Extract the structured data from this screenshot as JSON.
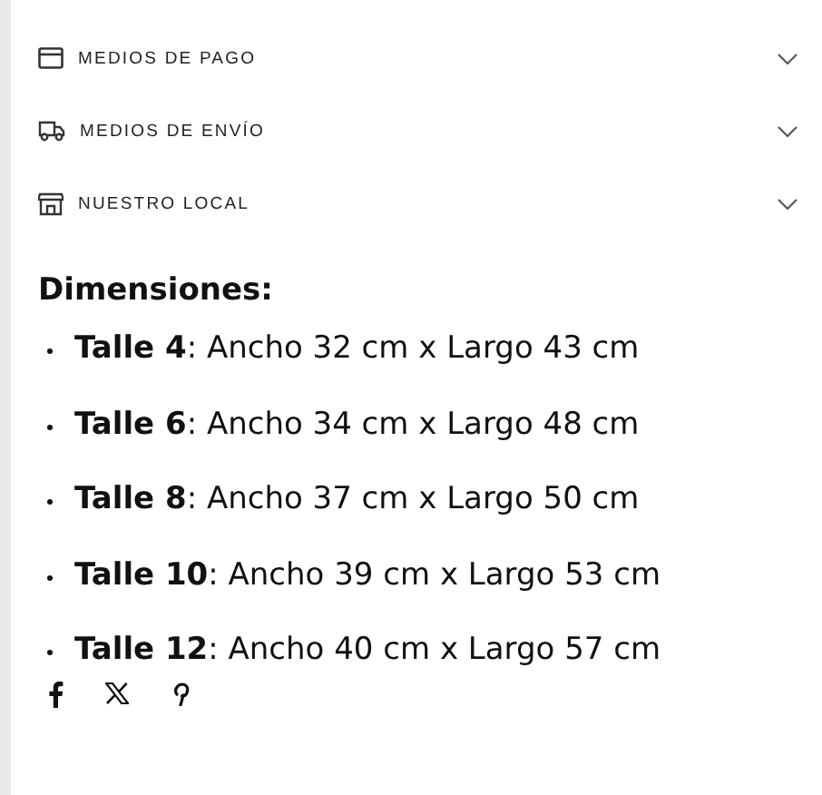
{
  "accordion": [
    {
      "label": "MEDIOS DE PAGO",
      "expanded": false
    },
    {
      "label": "MEDIOS DE ENVÍO",
      "expanded": false
    },
    {
      "label": "NUESTRO LOCAL",
      "expanded": false
    }
  ],
  "heading": "Dimensiones:",
  "sizes": [
    "**Talle 4**: Ancho 32 cm x Largo 43 cm",
    "**Talle 6**: Ancho 34 cm x Largo 48 cm",
    "**Talle 8**: Ancho 37 cm x Largo 50 cm",
    "**Talle 10**: Ancho 39 cm x Largo 53 cm",
    "**Talle 12**: Ancho 40 cm x Largo 57 cm"
  ]
}
